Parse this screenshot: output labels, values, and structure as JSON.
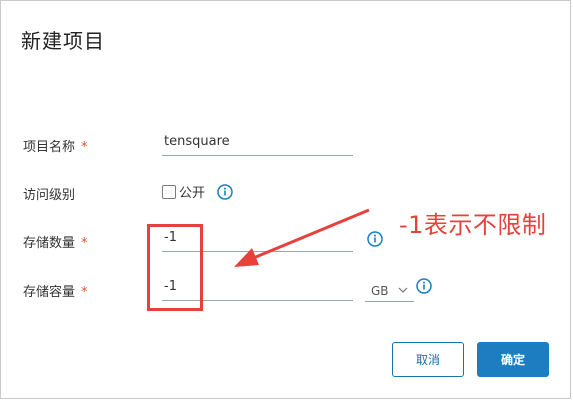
{
  "dialog": {
    "title": "新建项目",
    "fields": {
      "project_name": {
        "label": "项目名称",
        "required_mark": "*",
        "value": "tensquare"
      },
      "access_level": {
        "label": "访问级别",
        "checkbox_label": "公开",
        "checked": false,
        "info_icon": "info-circle-icon"
      },
      "storage_count": {
        "label": "存储数量",
        "required_mark": "*",
        "value": "-1",
        "info_icon": "info-circle-icon"
      },
      "storage_capacity": {
        "label": "存储容量",
        "required_mark": "*",
        "value": "-1",
        "unit": "GB",
        "info_icon": "info-circle-icon"
      }
    },
    "buttons": {
      "cancel": "取消",
      "confirm": "确定"
    }
  },
  "annotation": {
    "text": "-1表示不限制",
    "color": "#e8403a"
  },
  "colors": {
    "primary": "#1c7ec0",
    "required": "#e4542f",
    "info": "#1c7ec0"
  }
}
